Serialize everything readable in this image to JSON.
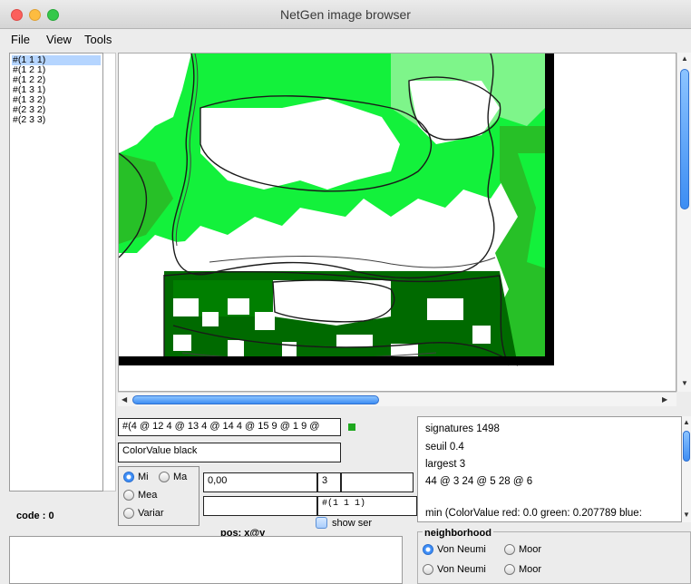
{
  "window": {
    "title": "NetGen image browser"
  },
  "colors": {
    "dark_green": "#006a00",
    "mid_green": "#27c027",
    "bright_green": "#13f13b",
    "light_green": "#7ef58a",
    "selection": "#b5d5ff",
    "accent": "#3e8ef7"
  },
  "menu": [
    "File",
    "View",
    "Tools"
  ],
  "list": {
    "items": [
      "#(1 1 1)",
      "#(1 2 1)",
      "#(1 2 2)",
      "#(1 3 1)",
      "#(1 3 2)",
      "#(2 3 2)",
      "#(2 3 3)"
    ],
    "selected_index": 0
  },
  "fields": {
    "expression": "#(4 @ 12 4 @ 13 4 @ 14 4 @ 15 9 @ 1 9 @",
    "color_value": "ColorValue black",
    "value_a": "0,00",
    "value_b": "3",
    "value_d": "#(1 1 1)"
  },
  "radios": {
    "options": [
      {
        "label": "Mi",
        "selected": true
      },
      {
        "label": "Ma",
        "selected": false
      },
      {
        "label": "Mea",
        "selected": false
      },
      {
        "label": "Variar",
        "selected": false
      }
    ]
  },
  "show_ser_label": "show ser",
  "pos_label": "pos: x@y",
  "code_label": "code : 0",
  "info": {
    "lines": [
      "signatures  1498",
      "seuil  0.4",
      "largest  3",
      "44 @ 3 24 @ 5 28 @ 6",
      "",
      "min (ColorValue red: 0.0 green: 0.207789 blue:"
    ]
  },
  "neighborhood": {
    "title": "neighborhood",
    "rows": [
      [
        {
          "label": "Von Neumi",
          "selected": true
        },
        {
          "label": "Moor",
          "selected": false
        }
      ],
      [
        {
          "label": "Von Neumi",
          "selected": false
        },
        {
          "label": "Moor",
          "selected": false
        }
      ]
    ]
  }
}
